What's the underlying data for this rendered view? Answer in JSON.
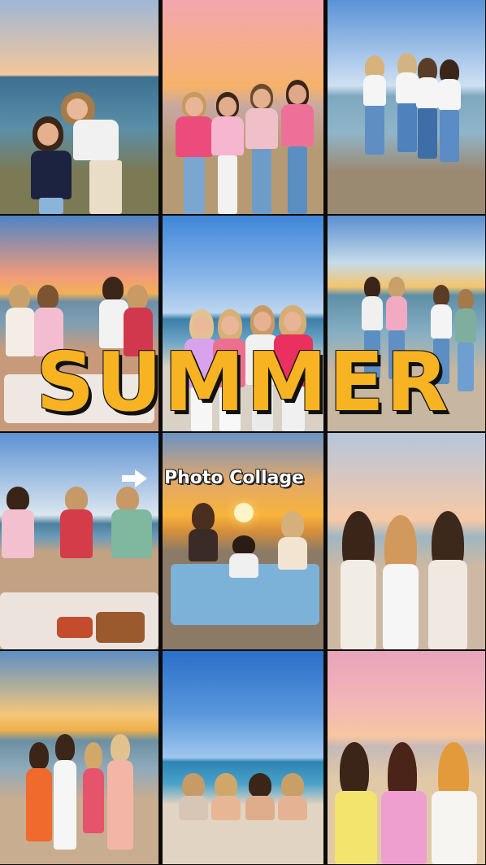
{
  "overlay": {
    "title": "SUMMER",
    "subtitle": "Photo Collage",
    "arrow_icon": "right-arrow-icon",
    "title_color": "#f7b321"
  },
  "tiles": [
    {
      "name": "photo-piggyback-coast",
      "sky": [
        "#9fb6d6",
        "#f3c79a"
      ],
      "sea": "#3d6f90",
      "sand": "#7b7a55"
    },
    {
      "name": "photo-group-sunset-pose",
      "sky": [
        "#f4a6b0",
        "#f6b36a"
      ],
      "sea": "#c7a8a0",
      "sand": "#b69a73"
    },
    {
      "name": "photo-walking-shoreline",
      "sky": [
        "#5a93d6",
        "#cfe0f2"
      ],
      "sea": "#7fa8bf",
      "sand": "#9b8a72"
    },
    {
      "name": "photo-picnic-sunset",
      "sky": [
        "#4f84c6",
        "#f2b057"
      ],
      "sea": "#6d8ea6",
      "sand": "#c79a7c"
    },
    {
      "name": "photo-group-hug-blue-sky",
      "sky": [
        "#3f86d8",
        "#bcd6ef"
      ],
      "sea": "#3c7fa8",
      "sand": "#d9d1c5"
    },
    {
      "name": "photo-dancing-beach",
      "sky": [
        "#5a8fd1",
        "#f4c46e"
      ],
      "sea": "#5d8fa8",
      "sand": "#c7b6a0"
    },
    {
      "name": "photo-picnic-flowers",
      "sky": [
        "#5d91d3",
        "#dbe6ef"
      ],
      "sea": "#4c7f9e",
      "sand": "#c3a283"
    },
    {
      "name": "photo-sunset-blanket",
      "sky": [
        "#6b93c4",
        "#f7b33a"
      ],
      "sea": "#d9903b",
      "sand": "#8a7a66"
    },
    {
      "name": "photo-heart-hands",
      "sky": [
        "#b7c5dc",
        "#f6c9a6"
      ],
      "sea": "#9fb6c1",
      "sand": "#cdb9a3"
    },
    {
      "name": "photo-sunset-twirl",
      "sky": [
        "#5d8fc5",
        "#f0b04a"
      ],
      "sea": "#6c8fa2",
      "sand": "#c9ad90"
    },
    {
      "name": "photo-lying-sand",
      "sky": [
        "#2a6fc9",
        "#9fc7ee"
      ],
      "sea": "#2e84b3",
      "sand": "#e2d4c2"
    },
    {
      "name": "photo-pastel-outfits",
      "sky": [
        "#e7a4bb",
        "#f7c6a0"
      ],
      "sea": "#c6b9b7",
      "sand": "#e1c9a8"
    }
  ]
}
